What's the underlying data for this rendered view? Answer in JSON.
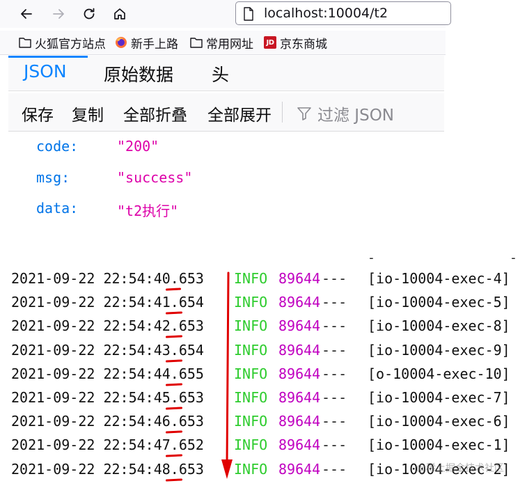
{
  "browser": {
    "url": "localhost:10004/t2",
    "bookmarks": [
      {
        "label": "火狐官方站点",
        "icon": "folder-icon"
      },
      {
        "label": "新手上路",
        "icon": "firefox-icon"
      },
      {
        "label": "常用网址",
        "icon": "folder-icon"
      },
      {
        "label": "京东商城",
        "icon": "jd-icon",
        "icon_text": "JD"
      }
    ]
  },
  "json_viewer": {
    "tabs": [
      "JSON",
      "原始数据",
      "头"
    ],
    "active_tab": "JSON",
    "toolbar": {
      "save": "保存",
      "copy": "复制",
      "collapse_all": "全部折叠",
      "expand_all": "全部展开",
      "filter_placeholder": "过滤 JSON"
    },
    "rows": [
      {
        "key": "code:",
        "value": "\"200\""
      },
      {
        "key": "msg:",
        "value": "\"success\""
      },
      {
        "key": "data:",
        "value": "\"t2执行\""
      }
    ]
  },
  "log": {
    "top_marks": [
      "-",
      "-"
    ],
    "lines": [
      {
        "timestamp": "2021-09-22 22:54:40.653",
        "level": "INFO",
        "pid": "89644",
        "sep": "---",
        "thread": "[io-10004-exec-4]"
      },
      {
        "timestamp": "2021-09-22 22:54:41.654",
        "level": "INFO",
        "pid": "89644",
        "sep": "---",
        "thread": "[io-10004-exec-5]"
      },
      {
        "timestamp": "2021-09-22 22:54:42.653",
        "level": "INFO",
        "pid": "89644",
        "sep": "---",
        "thread": "[io-10004-exec-8]"
      },
      {
        "timestamp": "2021-09-22 22:54:43.654",
        "level": "INFO",
        "pid": "89644",
        "sep": "---",
        "thread": "[io-10004-exec-9]"
      },
      {
        "timestamp": "2021-09-22 22:54:44.655",
        "level": "INFO",
        "pid": "89644",
        "sep": "---",
        "thread": "[o-10004-exec-10]"
      },
      {
        "timestamp": "2021-09-22 22:54:45.653",
        "level": "INFO",
        "pid": "89644",
        "sep": "---",
        "thread": "[io-10004-exec-7]"
      },
      {
        "timestamp": "2021-09-22 22:54:46.653",
        "level": "INFO",
        "pid": "89644",
        "sep": "---",
        "thread": "[io-10004-exec-6]"
      },
      {
        "timestamp": "2021-09-22 22:54:47.652",
        "level": "INFO",
        "pid": "89644",
        "sep": "---",
        "thread": "[io-10004-exec-1]"
      },
      {
        "timestamp": "2021-09-22 22:54:48.653",
        "level": "INFO",
        "pid": "89644",
        "sep": "---",
        "thread": "[io-10004-exec-2]"
      }
    ]
  },
  "watermark": "@稀土掘金技术社区",
  "colors": {
    "accent": "#0a84ff",
    "json_key": "#0074e8",
    "json_string": "#dd00a9",
    "log_info": "#2ecc2e",
    "log_pid": "#c000c0",
    "annotation": "#e00000"
  }
}
